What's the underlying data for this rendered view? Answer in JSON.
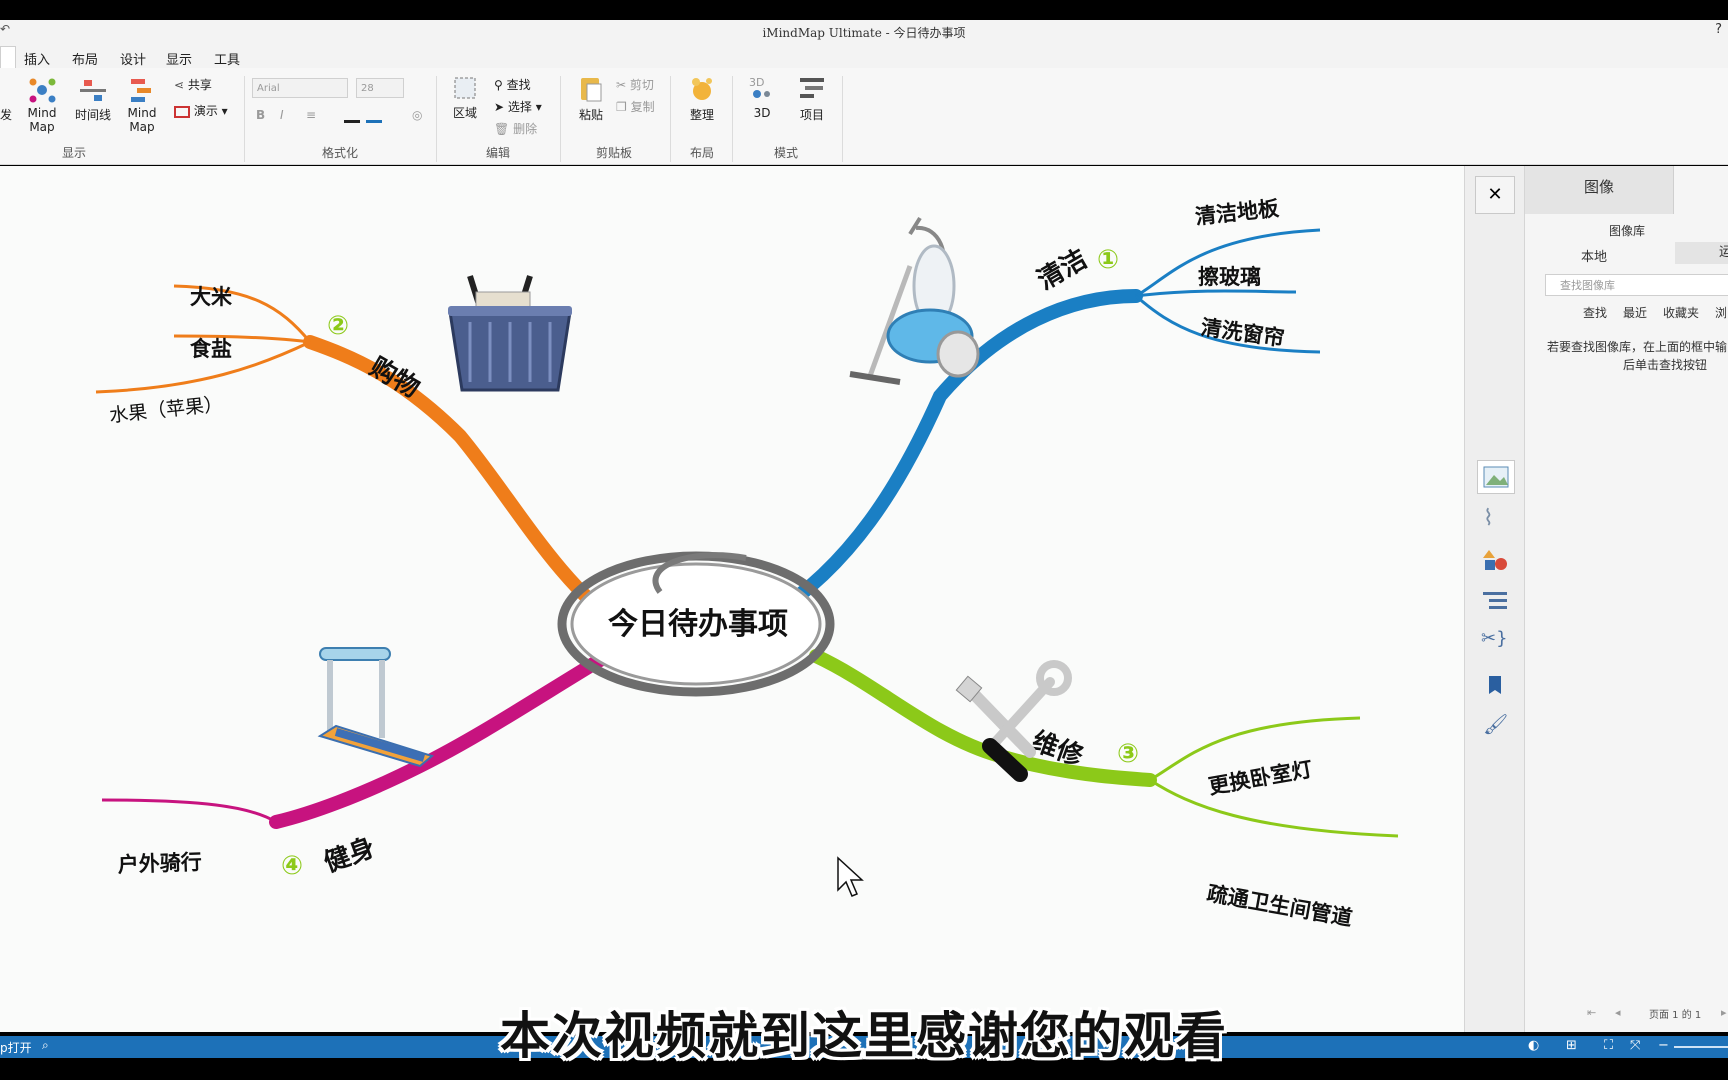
{
  "app": {
    "title": "iMindMap Ultimate - 今日待办事项",
    "help": "?",
    "undo": "↶"
  },
  "tabs": [
    "插入",
    "布局",
    "设计",
    "显示",
    "工具"
  ],
  "ribbon": {
    "display_group": {
      "label": "显示",
      "partial_label": "发",
      "mindmap1": "Mind Map",
      "timeline": "时间线",
      "mindmap2": "Mind Map",
      "share": "共享",
      "present": "演示"
    },
    "format_group": {
      "label": "格式化",
      "font": "Arial",
      "size": "28"
    },
    "edit_group": {
      "label": "编辑",
      "region": "区域",
      "find": "查找",
      "select": "选择",
      "delete": "删除"
    },
    "clipboard_group": {
      "label": "剪贴板",
      "paste": "粘贴",
      "cut": "剪切",
      "copy": "复制"
    },
    "layout_group": {
      "label": "布局",
      "arrange": "整理"
    },
    "mode_group": {
      "label": "模式",
      "threed": "3D",
      "project": "项目"
    }
  },
  "mindmap": {
    "central": "今日待办事项",
    "branches": [
      {
        "number": "①",
        "label": "清洁",
        "color": "#1a7fc4",
        "children": [
          "清洁地板",
          "擦玻璃",
          "清洗窗帘"
        ]
      },
      {
        "number": "②",
        "label": "购物",
        "color": "#ef7d1a",
        "children": [
          "大米",
          "食盐",
          "水果（苹果）"
        ]
      },
      {
        "number": "③",
        "label": "维修",
        "color": "#8cc919",
        "children": [
          "更换卧室灯",
          "疏通卫生间管道"
        ]
      },
      {
        "number": "④",
        "label": "健身",
        "color": "#c7137f",
        "children": [
          "户外骑行"
        ]
      }
    ]
  },
  "panel": {
    "tab": "图像",
    "library_title": "图像库",
    "local": "本地",
    "online_partial": "运",
    "search_placeholder": "查找图像库",
    "links": [
      "查找",
      "最近",
      "收藏夹",
      "浏"
    ],
    "hint_line1": "若要查找图像库，在上面的框中输",
    "hint_line2": "后单击查找按钮",
    "page": "页面 1 的 1",
    "close": "✕"
  },
  "status": {
    "left": "p打开"
  },
  "subtitle": "本次视频就到这里感谢您的观看"
}
